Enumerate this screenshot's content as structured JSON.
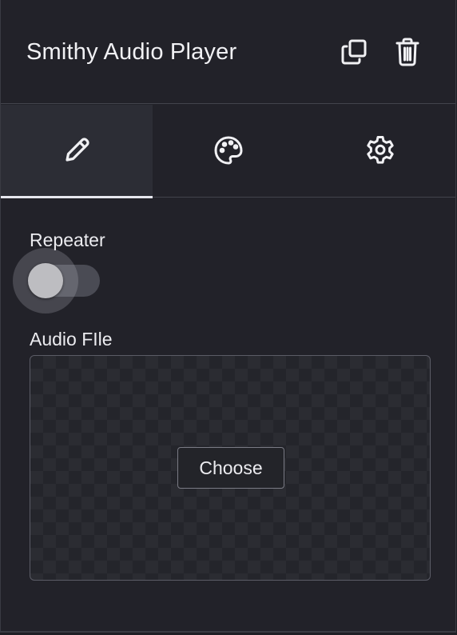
{
  "header": {
    "title": "Smithy Audio Player",
    "actions": [
      {
        "name": "duplicate",
        "icon": "copy-icon"
      },
      {
        "name": "delete",
        "icon": "trash-icon"
      }
    ]
  },
  "tabs": [
    {
      "name": "content",
      "icon": "pencil-icon",
      "active": true
    },
    {
      "name": "style",
      "icon": "palette-icon",
      "active": false
    },
    {
      "name": "settings",
      "icon": "gear-icon",
      "active": false
    }
  ],
  "fields": {
    "repeater": {
      "label": "Repeater",
      "enabled": false
    },
    "audio_file": {
      "label": "Audio FIle",
      "button_label": "Choose"
    }
  },
  "colors": {
    "background": "#222229",
    "active_tab": "#2c2d35",
    "text": "#ececf0",
    "border": "#43444c"
  }
}
